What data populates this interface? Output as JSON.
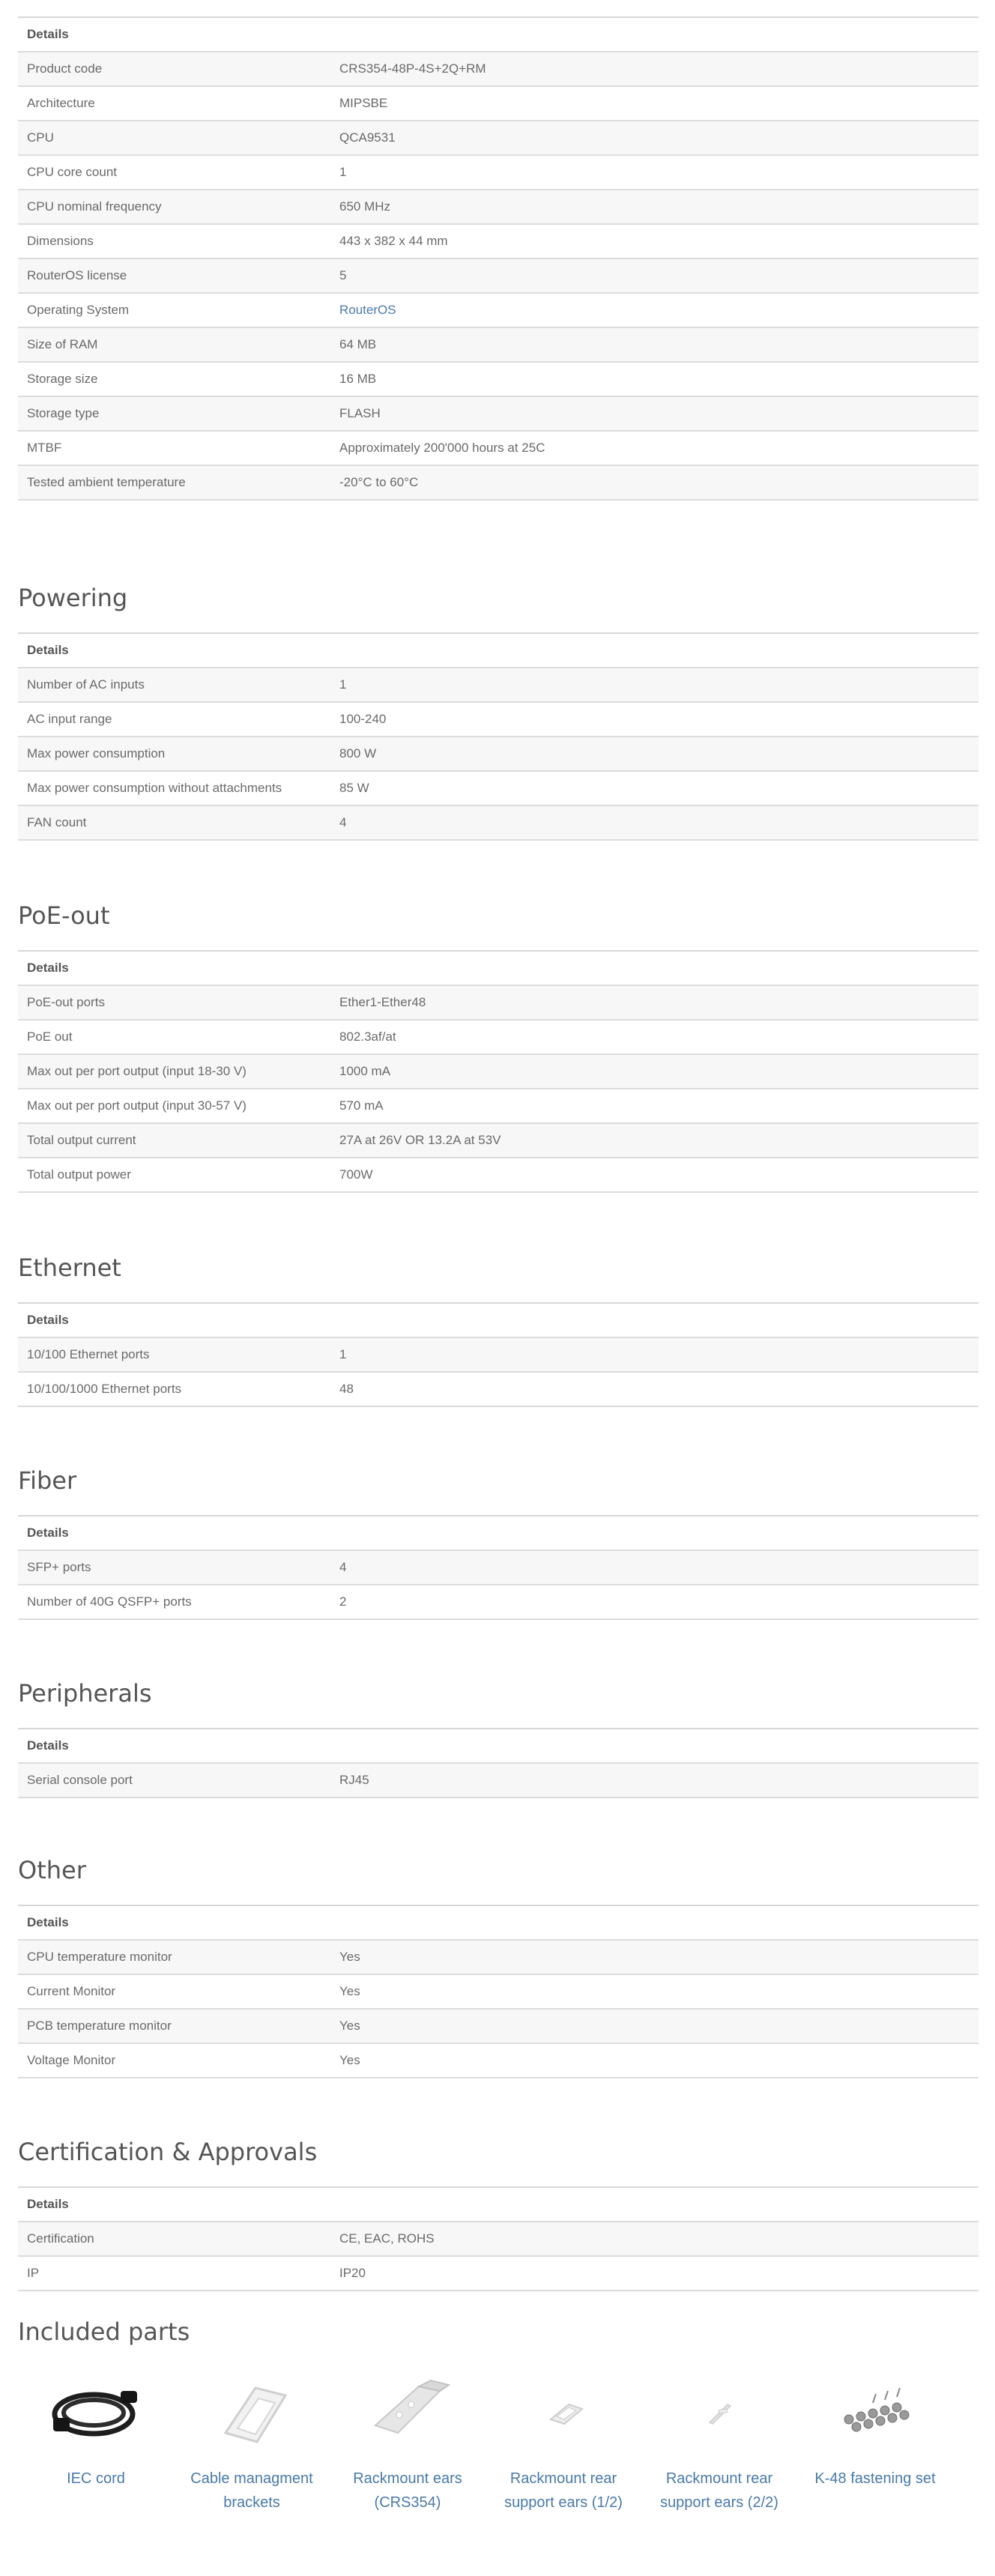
{
  "general": {
    "header": "Details",
    "rows": [
      {
        "k": "Product code",
        "v": "CRS354-48P-4S+2Q+RM"
      },
      {
        "k": "Architecture",
        "v": "MIPSBE"
      },
      {
        "k": "CPU",
        "v": "QCA9531"
      },
      {
        "k": "CPU core count",
        "v": "1"
      },
      {
        "k": "CPU nominal frequency",
        "v": "650 MHz"
      },
      {
        "k": "Dimensions",
        "v": "443 x 382 x 44 mm"
      },
      {
        "k": "RouterOS license",
        "v": "5"
      },
      {
        "k": "Operating System",
        "v": "RouterOS"
      },
      {
        "k": "Size of RAM",
        "v": "64 MB"
      },
      {
        "k": "Storage size",
        "v": "16 MB"
      },
      {
        "k": "Storage type",
        "v": "FLASH"
      },
      {
        "k": "MTBF",
        "v": "Approximately 200'000 hours at 25C"
      },
      {
        "k": "Tested ambient temperature",
        "v": "-20°C to 60°C"
      }
    ]
  },
  "powering": {
    "title": "Powering",
    "header": "Details",
    "rows": [
      {
        "k": "Number of AC inputs",
        "v": "1"
      },
      {
        "k": "AC input range",
        "v": "100-240"
      },
      {
        "k": "Max power consumption",
        "v": "800 W"
      },
      {
        "k": "Max power consumption without attachments",
        "v": "85 W"
      },
      {
        "k": "FAN count",
        "v": "4"
      }
    ]
  },
  "poe": {
    "title": "PoE-out",
    "header": "Details",
    "rows": [
      {
        "k": "PoE-out ports",
        "v": "Ether1-Ether48"
      },
      {
        "k": "PoE out",
        "v": "802.3af/at"
      },
      {
        "k": "Max out per port output (input 18-30 V)",
        "v": "1000 mA"
      },
      {
        "k": "Max out per port output (input 30-57 V)",
        "v": "570 mA"
      },
      {
        "k": "Total output current",
        "v": "27A at 26V OR 13.2A at 53V"
      },
      {
        "k": "Total output power",
        "v": "700W"
      }
    ]
  },
  "ethernet": {
    "title": "Ethernet",
    "header": "Details",
    "rows": [
      {
        "k": "10/100 Ethernet ports",
        "v": "1"
      },
      {
        "k": "10/100/1000 Ethernet ports",
        "v": "48"
      }
    ]
  },
  "fiber": {
    "title": "Fiber",
    "header": "Details",
    "rows": [
      {
        "k": "SFP+ ports",
        "v": "4"
      },
      {
        "k": "Number of 40G QSFP+ ports",
        "v": "2"
      }
    ]
  },
  "peripherals": {
    "title": "Peripherals",
    "header": "Details",
    "rows": [
      {
        "k": "Serial console port",
        "v": "RJ45"
      }
    ]
  },
  "other": {
    "title": "Other",
    "header": "Details",
    "rows": [
      {
        "k": "CPU temperature monitor",
        "v": "Yes"
      },
      {
        "k": "Current Monitor",
        "v": "Yes"
      },
      {
        "k": "PCB temperature monitor",
        "v": "Yes"
      },
      {
        "k": "Voltage Monitor",
        "v": "Yes"
      }
    ]
  },
  "certification": {
    "title": "Certification & Approvals",
    "header": "Details",
    "rows": [
      {
        "k": "Certification",
        "v": "CE, EAC, ROHS"
      },
      {
        "k": "IP",
        "v": "IP20"
      }
    ]
  },
  "included": {
    "title": "Included parts",
    "items": [
      {
        "label": "IEC cord",
        "icon": "iec-cord-icon"
      },
      {
        "label": "Cable managment brackets",
        "icon": "cable-bracket-icon"
      },
      {
        "label": "Rackmount ears (CRS354)",
        "icon": "rackmount-ear-icon"
      },
      {
        "label": "Rackmount rear support ears (1/2)",
        "icon": "rear-support-ear-icon"
      },
      {
        "label": "Rackmount rear support ears (2/2)",
        "icon": "rear-support-ear-2-icon"
      },
      {
        "label": "K-48 fastening set",
        "icon": "screws-icon"
      }
    ]
  },
  "colors": {
    "link": "#4a7aa8",
    "stripe": "#f7f7f7",
    "border": "#dcdcdc"
  }
}
